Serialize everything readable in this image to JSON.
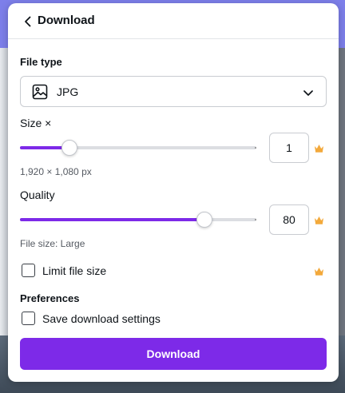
{
  "colors": {
    "accent": "#7d2ae8",
    "premium": "#f3a93b",
    "text": "#0e1318",
    "muted": "#555a62"
  },
  "header": {
    "back_icon": "chevron-left-icon",
    "title": "Download"
  },
  "file_type": {
    "label": "File type",
    "icon": "image-icon",
    "selected": "JPG",
    "dropdown_icon": "chevron-down-icon"
  },
  "size": {
    "label": "Size ×",
    "value": "1",
    "slider_fraction": 0.21,
    "dimensions": "1,920 × 1,080 px",
    "premium_icon": "crown-icon"
  },
  "quality": {
    "label": "Quality",
    "value": "80",
    "slider_fraction": 0.78,
    "file_size": "File size: Large",
    "premium_icon": "crown-icon"
  },
  "limit_file_size": {
    "label": "Limit file size",
    "checked": false,
    "premium_icon": "crown-icon"
  },
  "preferences": {
    "heading": "Preferences",
    "save_settings_label": "Save download settings",
    "checked": false
  },
  "download_button": {
    "label": "Download"
  }
}
